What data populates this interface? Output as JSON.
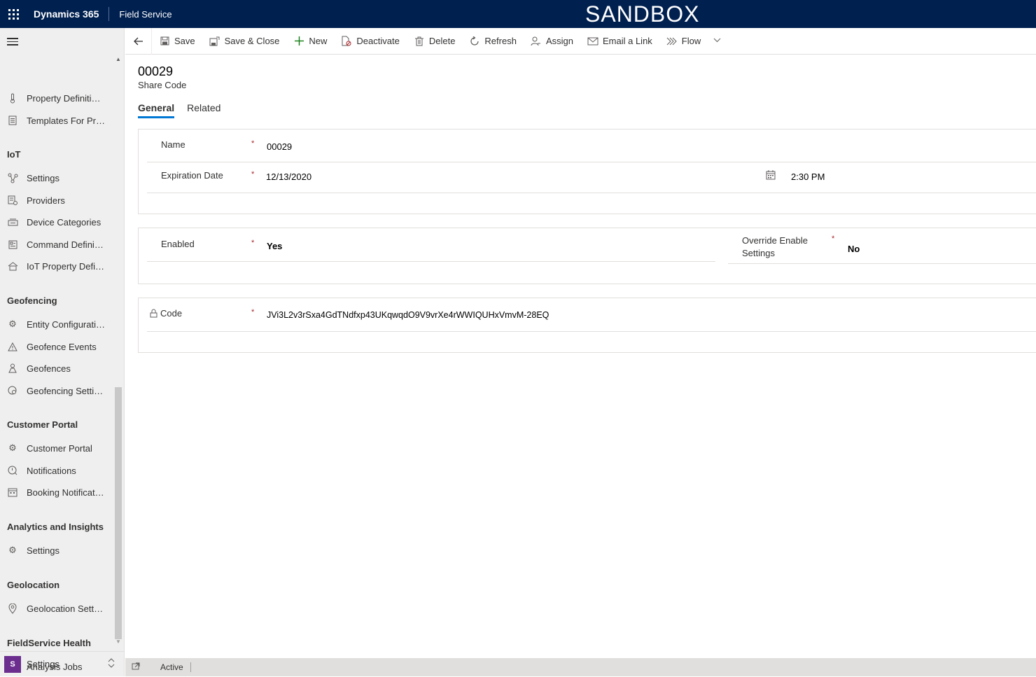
{
  "topbar": {
    "brand": "Dynamics 365",
    "app": "Field Service",
    "environment": "SANDBOX",
    "bg_color": "#002050"
  },
  "sidebar": {
    "groups": {
      "iot": "IoT",
      "geofencing": "Geofencing",
      "customer_portal": "Customer Portal",
      "analytics": "Analytics and Insights",
      "geolocation": "Geolocation",
      "health": "FieldService Health"
    },
    "items": {
      "property_definitions": {
        "label": "Property Definitions",
        "icon": "thermometer-icon"
      },
      "templates": {
        "label": "Templates For Properties",
        "icon": "document-icon"
      },
      "iot_settings": {
        "label": "Settings",
        "icon": "iot-settings-icon"
      },
      "providers": {
        "label": "Providers",
        "icon": "providers-icon"
      },
      "device_categories": {
        "label": "Device Categories",
        "icon": "device-categories-icon"
      },
      "command_definitions": {
        "label": "Command Definitions",
        "icon": "command-icon"
      },
      "iot_property_definitions": {
        "label": "IoT Property Definitions",
        "icon": "iot-property-icon"
      },
      "entity_configurations": {
        "label": "Entity Configurations",
        "icon": "gear-icon"
      },
      "geofence_events": {
        "label": "Geofence Events",
        "icon": "warning-icon"
      },
      "geofences": {
        "label": "Geofences",
        "icon": "person-location-icon"
      },
      "geofencing_settings": {
        "label": "Geofencing Settings",
        "icon": "geo-gear-icon"
      },
      "customer_portal": {
        "label": "Customer Portal",
        "icon": "gear-icon"
      },
      "notifications": {
        "label": "Notifications",
        "icon": "notification-icon"
      },
      "booking_notifications": {
        "label": "Booking Notifications",
        "icon": "calendar-icon"
      },
      "analytics_settings": {
        "label": "Settings",
        "icon": "gear-icon"
      },
      "geolocation_settings": {
        "label": "Geolocation Settings",
        "icon": "location-pin-icon"
      },
      "analysis_jobs": {
        "label": "Analysis Jobs",
        "icon": "report-icon"
      }
    },
    "area": {
      "badge": "S",
      "label": "Settings",
      "badge_color": "#6b2d8e"
    }
  },
  "commands": {
    "save": "Save",
    "save_close": "Save & Close",
    "new": "New",
    "deactivate": "Deactivate",
    "delete": "Delete",
    "refresh": "Refresh",
    "assign": "Assign",
    "email_link": "Email a Link",
    "flow": "Flow"
  },
  "record": {
    "title": "00029",
    "entity": "Share Code"
  },
  "tabs": {
    "general": "General",
    "related": "Related"
  },
  "fields": {
    "name": {
      "label": "Name",
      "value": "00029"
    },
    "expiration": {
      "label": "Expiration Date",
      "date": "12/13/2020",
      "time": "2:30 PM"
    },
    "enabled": {
      "label": "Enabled",
      "value": "Yes"
    },
    "override": {
      "label_line1": "Override Enable",
      "label_line2": "Settings",
      "value": "No"
    },
    "code": {
      "label": "Code",
      "value": "JVi3L2v3rSxa4GdTNdfxp43UKqwqdO9V9vrXe4rWWIQUHxVmvM-28EQ"
    }
  },
  "required_mark": "*",
  "status": {
    "text": "Active"
  },
  "accent_color": "#0078d4"
}
